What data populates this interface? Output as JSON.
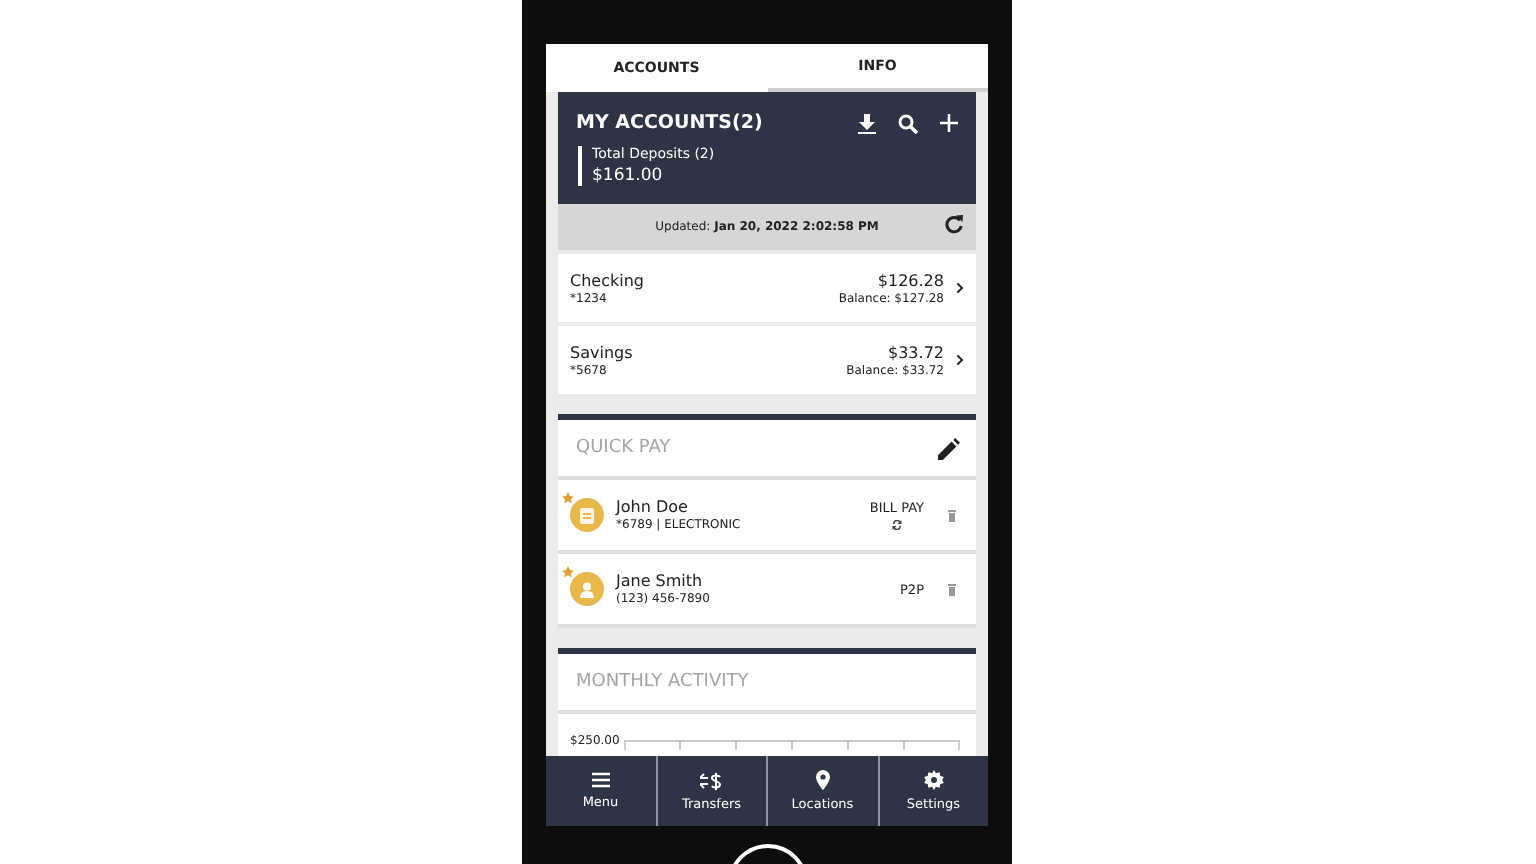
{
  "tabs": [
    {
      "label": "ACCOUNTS",
      "selected": true
    },
    {
      "label": "INFO",
      "selected": false
    }
  ],
  "summary": {
    "title": "MY ACCOUNTS(2)",
    "total_label": "Total Deposits (2)",
    "total_value": "$161.00"
  },
  "updated": "Updated: **Jan 20, 2022 2:02:58 PM**",
  "accounts": [
    {
      "name": "Checking",
      "number": "*1234",
      "amount": "$126.28",
      "balance": "Balance: $127.28"
    },
    {
      "name": "Savings",
      "number": "*5678",
      "amount": "$33.72",
      "balance": "Balance: $33.72"
    }
  ],
  "quick_pay": {
    "title": "QUICK PAY",
    "payees": [
      {
        "kind": "bill",
        "name": "John Doe",
        "detail": "*6789 | ELECTRONIC",
        "type": "BILL PAY",
        "recurring": true
      },
      {
        "kind": "person",
        "name": "Jane Smith",
        "detail": "(123) 456-7890",
        "type": "P2P",
        "recurring": false
      }
    ]
  },
  "monthly_activity": {
    "title": "MONTHLY ACTIVITY",
    "axis_label": "$250.00"
  },
  "nav": [
    {
      "kind": "menu",
      "label": "Menu"
    },
    {
      "kind": "transfers",
      "label": "Transfers"
    },
    {
      "kind": "locations",
      "label": "Locations"
    },
    {
      "kind": "settings",
      "label": "Settings"
    }
  ]
}
